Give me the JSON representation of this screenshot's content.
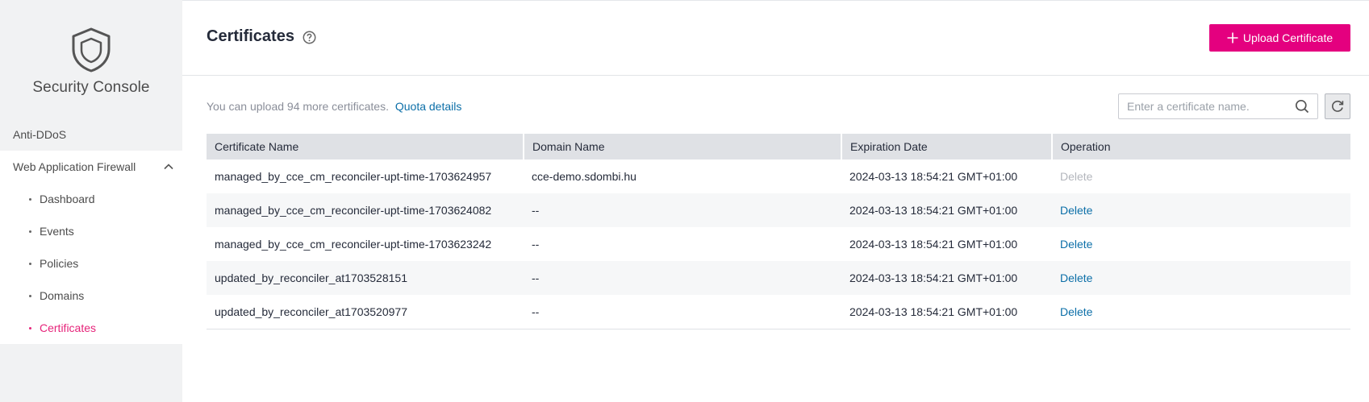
{
  "sidebar": {
    "title": "Security Console",
    "items": [
      {
        "label": "Anti-DDoS"
      },
      {
        "label": "Web Application Firewall"
      }
    ],
    "waf_subitems": [
      {
        "label": "Dashboard"
      },
      {
        "label": "Events"
      },
      {
        "label": "Policies"
      },
      {
        "label": "Domains"
      },
      {
        "label": "Certificates"
      }
    ],
    "active_subitem": "Certificates"
  },
  "header": {
    "title": "Certificates",
    "upload_label": "Upload Certificate"
  },
  "toolbar": {
    "quota_text": "You can upload 94 more certificates.",
    "quota_link": "Quota details",
    "search_placeholder": "Enter a certificate name."
  },
  "table": {
    "columns": [
      "Certificate Name",
      "Domain Name",
      "Expiration Date",
      "Operation"
    ],
    "rows": [
      {
        "name": "managed_by_cce_cm_reconciler-upt-time-1703624957",
        "domain": "cce-demo.sdombi.hu",
        "expires": "2024-03-13 18:54:21 GMT+01:00",
        "operation": "Delete",
        "disabled": true
      },
      {
        "name": "managed_by_cce_cm_reconciler-upt-time-1703624082",
        "domain": "--",
        "expires": "2024-03-13 18:54:21 GMT+01:00",
        "operation": "Delete",
        "disabled": false
      },
      {
        "name": "managed_by_cce_cm_reconciler-upt-time-1703623242",
        "domain": "--",
        "expires": "2024-03-13 18:54:21 GMT+01:00",
        "operation": "Delete",
        "disabled": false
      },
      {
        "name": "updated_by_reconciler_at1703528151",
        "domain": "--",
        "expires": "2024-03-13 18:54:21 GMT+01:00",
        "operation": "Delete",
        "disabled": false
      },
      {
        "name": "updated_by_reconciler_at1703520977",
        "domain": "--",
        "expires": "2024-03-13 18:54:21 GMT+01:00",
        "operation": "Delete",
        "disabled": false
      }
    ]
  },
  "colors": {
    "accent": "#e4007f",
    "link": "#0c6fa8",
    "active_nav": "#e6247a"
  },
  "icons": {
    "console_logo": "shield-icon",
    "help": "question-circle-icon",
    "collapse": "chevron-up-icon",
    "upload": "plus-icon",
    "search": "search-icon",
    "refresh": "refresh-icon"
  }
}
